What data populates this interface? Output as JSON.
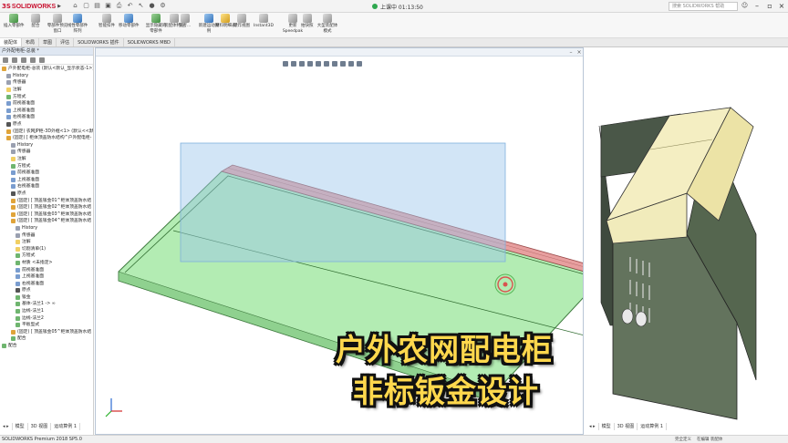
{
  "app": {
    "logo_ds": "3S",
    "logo_text": "SOLIDWORKS",
    "record_label": "上课中 01:13:50",
    "search_placeholder": "搜索 SOLIDWORKS 帮助"
  },
  "ribbon": [
    {
      "label": "插入零部件",
      "icon": "g"
    },
    {
      "label": "配合",
      "icon": "gr"
    },
    {
      "label": "零部件预览窗口",
      "icon": "gr"
    },
    {
      "label": "线性零部件阵列",
      "icon": "b"
    },
    {
      "label": "智能扣件",
      "icon": "gr"
    },
    {
      "label": "移动零部件",
      "icon": "b"
    },
    {
      "label": "显示隐藏的零部件",
      "icon": "g"
    },
    {
      "label": "装配体特征",
      "icon": "gr"
    },
    {
      "label": "参考...",
      "icon": "gr"
    },
    {
      "label": "新建运动算例",
      "icon": "b"
    },
    {
      "label": "材料明细表",
      "icon": "y"
    },
    {
      "label": "爆炸视图",
      "icon": "gr"
    },
    {
      "label": "Instant3D",
      "icon": "gr"
    },
    {
      "label": "更新 Speedpak",
      "icon": "gr"
    },
    {
      "label": "拍快照",
      "icon": "gr"
    },
    {
      "label": "大型装配体模式",
      "icon": "gr"
    }
  ],
  "tabs": [
    "装配体",
    "布局",
    "草图",
    "评估",
    "SOLIDWORKS 插件",
    "SOLIDWORKS MBD"
  ],
  "doc_tab": "户外配电柜-总装 *",
  "tree": [
    {
      "text": "户外配电柜-总装 (默认<默认_显示状态-1>)",
      "icon": "part",
      "indent": 0
    },
    {
      "text": "History",
      "icon": "hist",
      "indent": 1
    },
    {
      "text": "传感器",
      "icon": "hist",
      "indent": 1
    },
    {
      "text": "注解",
      "icon": "fold",
      "indent": 1
    },
    {
      "text": "方程式",
      "icon": "feat",
      "indent": 1
    },
    {
      "text": "前视基准面",
      "icon": "plane",
      "indent": 1
    },
    {
      "text": "上视基准面",
      "icon": "plane",
      "indent": 1
    },
    {
      "text": "右视基准面",
      "icon": "plane",
      "indent": 1
    },
    {
      "text": "原点",
      "icon": "pt",
      "indent": 1
    },
    {
      "text": "(固定) 农网JP柜-3D外框<1> (默认<<默认",
      "icon": "part",
      "indent": 1
    },
    {
      "text": "(固定) [ 柜体顶盖防水结构^户外配电柜-",
      "icon": "part",
      "indent": 1
    },
    {
      "text": "History",
      "icon": "hist",
      "indent": 2
    },
    {
      "text": "传感器",
      "icon": "hist",
      "indent": 2
    },
    {
      "text": "注解",
      "icon": "fold",
      "indent": 2
    },
    {
      "text": "方程式",
      "icon": "feat",
      "indent": 2
    },
    {
      "text": "前视基准面",
      "icon": "plane",
      "indent": 2
    },
    {
      "text": "上视基准面",
      "icon": "plane",
      "indent": 2
    },
    {
      "text": "右视基准面",
      "icon": "plane",
      "indent": 2
    },
    {
      "text": "原点",
      "icon": "pt",
      "indent": 2
    },
    {
      "text": "(固定) [ 顶盖钣金01^柜体顶盖防水结",
      "icon": "part",
      "indent": 2
    },
    {
      "text": "(固定) [ 顶盖钣金02^柜体顶盖防水结",
      "icon": "part",
      "indent": 2
    },
    {
      "text": "(固定) [ 顶盖钣金03^柜体顶盖防水结",
      "icon": "part",
      "indent": 2
    },
    {
      "text": "(固定) [ 顶盖钣金04^柜体顶盖防水结",
      "icon": "part",
      "indent": 2
    },
    {
      "text": "History",
      "icon": "hist",
      "indent": 3
    },
    {
      "text": "传感器",
      "icon": "hist",
      "indent": 3
    },
    {
      "text": "注解",
      "icon": "fold",
      "indent": 3
    },
    {
      "text": "切割清单(1)",
      "icon": "fold",
      "indent": 3
    },
    {
      "text": "方程式",
      "icon": "feat",
      "indent": 3
    },
    {
      "text": "材质 <未指定>",
      "icon": "feat",
      "indent": 3
    },
    {
      "text": "前视基准面",
      "icon": "plane",
      "indent": 3
    },
    {
      "text": "上视基准面",
      "icon": "plane",
      "indent": 3
    },
    {
      "text": "右视基准面",
      "icon": "plane",
      "indent": 3
    },
    {
      "text": "原点",
      "icon": "pt",
      "indent": 3
    },
    {
      "text": "钣金",
      "icon": "feat",
      "indent": 3
    },
    {
      "text": "基体-法兰1 -> ∞",
      "icon": "feat",
      "indent": 3
    },
    {
      "text": "边线-法兰1",
      "icon": "feat",
      "indent": 3
    },
    {
      "text": "边线-法兰2",
      "icon": "feat",
      "indent": 3
    },
    {
      "text": "平板型式",
      "icon": "feat",
      "indent": 3
    },
    {
      "text": "(固定) [ 顶盖钣金05^柜体顶盖防水结",
      "icon": "part",
      "indent": 2
    },
    {
      "text": "配合",
      "icon": "feat",
      "indent": 2
    },
    {
      "text": "配合",
      "icon": "feat",
      "indent": 0
    }
  ],
  "bottom_tabs_main": [
    "模型",
    "3D 视图",
    "运动算例 1"
  ],
  "bottom_tabs_right": [
    "模型",
    "3D 视图",
    "运动算例 1"
  ],
  "status": {
    "left": "SOLIDWORKS Premium 2018 SP5.0",
    "right": [
      "完全定义",
      "在编辑 装配体"
    ]
  },
  "caption": {
    "line1": "户外农网配电柜",
    "line2": "非标钣金设计"
  },
  "colors": {
    "selection_box": "#9cc6ec",
    "sheet_green": "#a8e6a8",
    "sheet_red": "#e9a3a3",
    "cabinet_roof": "#f1ebbb",
    "cabinet_body": "#4d5d4a",
    "caption_fill": "#ffd84d"
  }
}
